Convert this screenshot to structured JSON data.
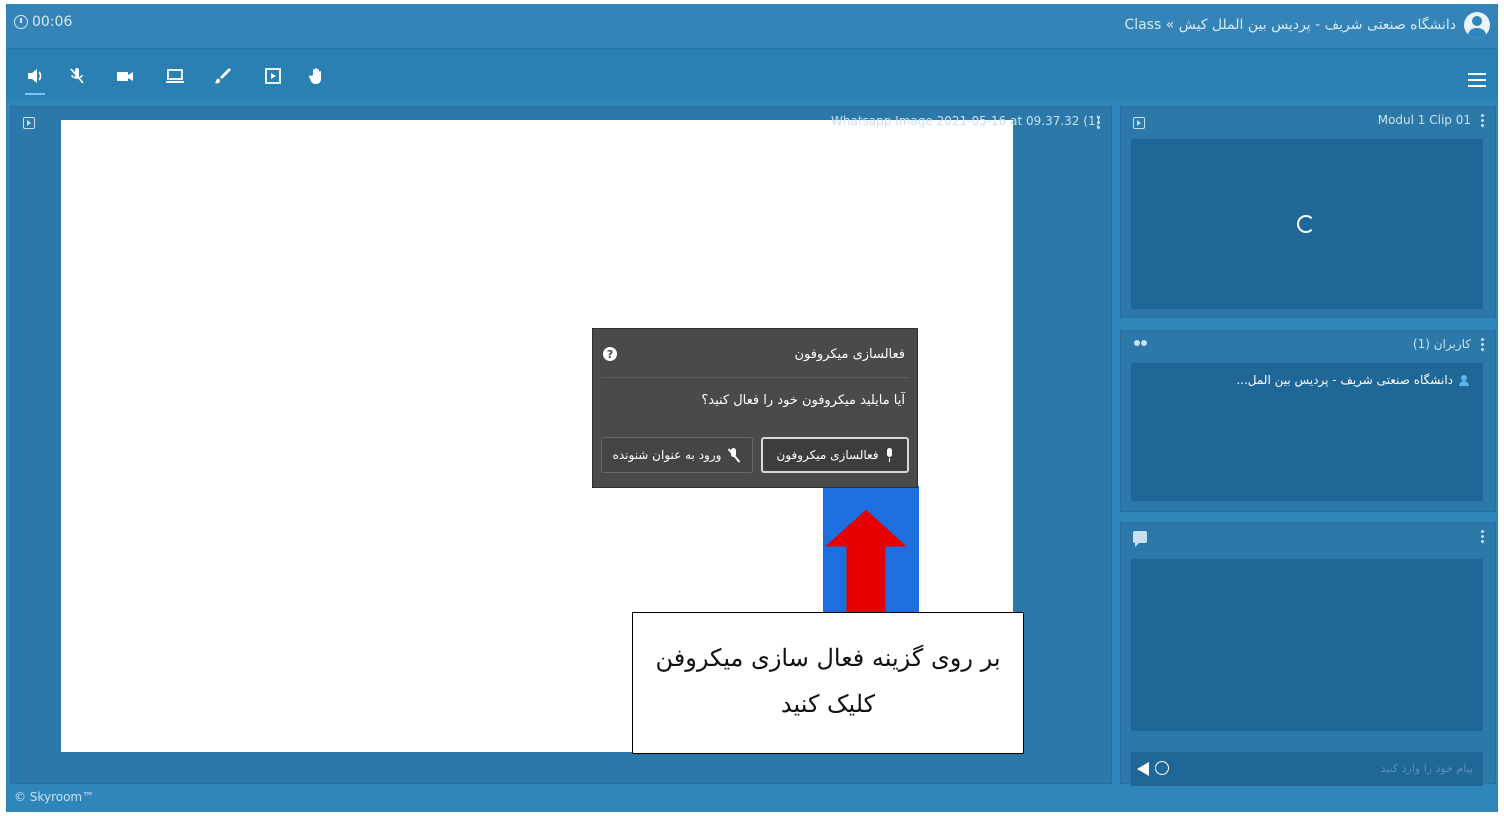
{
  "header": {
    "timer": "00:06",
    "breadcrumb": "دانشگاه صنعتی شریف - پردیس بین الملل کیش » Class"
  },
  "toolbar": {
    "tools": [
      "speaker-icon",
      "mic-muted-icon",
      "camera-icon",
      "screen-share-icon",
      "brush-icon",
      "file-play-icon",
      "raise-hand-icon"
    ],
    "active_tool": "speaker-icon",
    "menu_icon": "hamburger-menu-icon"
  },
  "main_panel": {
    "file_label": "Whatsapp Image 2021-05-16 at 09.37.32 (1)"
  },
  "video_panel": {
    "title": "Modul 1 Clip 01"
  },
  "users_panel": {
    "title": "کاربران (1)",
    "users": [
      "دانشگاه صنعتی شریف - پردیس بین المل..."
    ]
  },
  "chat_panel": {
    "placeholder": "پیام خود را وارد کنید"
  },
  "dialog": {
    "title": "فعالسازی میکروفون",
    "message": "آیا مایلید میکروفون خود را فعال کنید؟",
    "activate_label": "فعالسازی میکروفون",
    "listener_label": "ورود به عنوان شنونده"
  },
  "annotation": {
    "line1": "بر روی گزینه فعال سازی میکروفن",
    "line2": "کلیک کنید",
    "arrow_color": "#e60000",
    "highlight_color": "#1d6fe0"
  },
  "footer": {
    "copyright": "© Skyroom™"
  },
  "colors": {
    "background": "#2e86ba",
    "panel": "#2b78a9",
    "panel_body": "#1f6796",
    "dialog": "#4a4a4a"
  }
}
